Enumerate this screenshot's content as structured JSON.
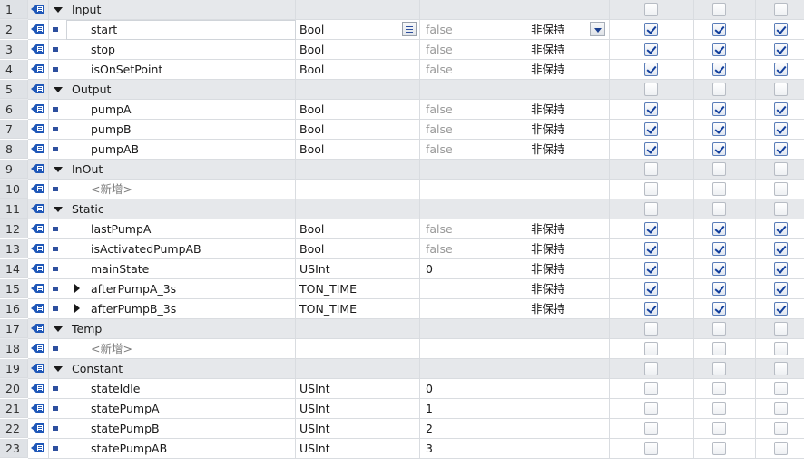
{
  "rows": [
    {
      "num": "1",
      "kind": "section",
      "name": "Input",
      "type": "",
      "default": "",
      "retain": "",
      "c1": false,
      "c2": false,
      "c3": false
    },
    {
      "num": "2",
      "kind": "var",
      "name": "start",
      "type": "Bool",
      "default": "false",
      "retain": "非保持",
      "c1": true,
      "c2": true,
      "c3": true,
      "selected": true
    },
    {
      "num": "3",
      "kind": "var",
      "name": "stop",
      "type": "Bool",
      "default": "false",
      "retain": "非保持",
      "c1": true,
      "c2": true,
      "c3": true
    },
    {
      "num": "4",
      "kind": "var",
      "name": "isOnSetPoint",
      "type": "Bool",
      "default": "false",
      "retain": "非保持",
      "c1": true,
      "c2": true,
      "c3": true
    },
    {
      "num": "5",
      "kind": "section",
      "name": "Output",
      "type": "",
      "default": "",
      "retain": "",
      "c1": false,
      "c2": false,
      "c3": false
    },
    {
      "num": "6",
      "kind": "var",
      "name": "pumpA",
      "type": "Bool",
      "default": "false",
      "retain": "非保持",
      "c1": true,
      "c2": true,
      "c3": true
    },
    {
      "num": "7",
      "kind": "var",
      "name": "pumpB",
      "type": "Bool",
      "default": "false",
      "retain": "非保持",
      "c1": true,
      "c2": true,
      "c3": true
    },
    {
      "num": "8",
      "kind": "var",
      "name": "pumpAB",
      "type": "Bool",
      "default": "false",
      "retain": "非保持",
      "c1": true,
      "c2": true,
      "c3": true
    },
    {
      "num": "9",
      "kind": "section",
      "name": "InOut",
      "type": "",
      "default": "",
      "retain": "",
      "c1": false,
      "c2": false,
      "c3": false
    },
    {
      "num": "10",
      "kind": "add",
      "name": "<新增>",
      "type": "",
      "default": "",
      "retain": "",
      "c1": false,
      "c2": false,
      "c3": false
    },
    {
      "num": "11",
      "kind": "section",
      "name": "Static",
      "type": "",
      "default": "",
      "retain": "",
      "c1": false,
      "c2": false,
      "c3": false
    },
    {
      "num": "12",
      "kind": "var",
      "name": "lastPumpA",
      "type": "Bool",
      "default": "false",
      "retain": "非保持",
      "c1": true,
      "c2": true,
      "c3": true
    },
    {
      "num": "13",
      "kind": "var",
      "name": "isActivatedPumpAB",
      "type": "Bool",
      "default": "false",
      "retain": "非保持",
      "c1": true,
      "c2": true,
      "c3": true
    },
    {
      "num": "14",
      "kind": "var",
      "name": "mainState",
      "type": "USInt",
      "default": "0",
      "retain": "非保持",
      "c1": true,
      "c2": true,
      "c3": true
    },
    {
      "num": "15",
      "kind": "struct",
      "name": "afterPumpA_3s",
      "type": "TON_TIME",
      "default": "",
      "retain": "非保持",
      "c1": true,
      "c2": true,
      "c3": true
    },
    {
      "num": "16",
      "kind": "struct",
      "name": "afterPumpB_3s",
      "type": "TON_TIME",
      "default": "",
      "retain": "非保持",
      "c1": true,
      "c2": true,
      "c3": true
    },
    {
      "num": "17",
      "kind": "section",
      "name": "Temp",
      "type": "",
      "default": "",
      "retain": "",
      "c1": false,
      "c2": false,
      "c3": false
    },
    {
      "num": "18",
      "kind": "add",
      "name": "<新增>",
      "type": "",
      "default": "",
      "retain": "",
      "c1": false,
      "c2": false,
      "c3": false
    },
    {
      "num": "19",
      "kind": "section",
      "name": "Constant",
      "type": "",
      "default": "",
      "retain": "",
      "c1": false,
      "c2": false,
      "c3": false
    },
    {
      "num": "20",
      "kind": "const",
      "name": "stateIdle",
      "type": "USInt",
      "default": "0",
      "retain": "",
      "c1": false,
      "c2": false,
      "c3": false
    },
    {
      "num": "21",
      "kind": "const",
      "name": "statePumpA",
      "type": "USInt",
      "default": "1",
      "retain": "",
      "c1": false,
      "c2": false,
      "c3": false
    },
    {
      "num": "22",
      "kind": "const",
      "name": "statePumpB",
      "type": "USInt",
      "default": "2",
      "retain": "",
      "c1": false,
      "c2": false,
      "c3": false
    },
    {
      "num": "23",
      "kind": "const",
      "name": "statePumpAB",
      "type": "USInt",
      "default": "3",
      "retain": "",
      "c1": false,
      "c2": false,
      "c3": false
    }
  ],
  "icons": {
    "interface": "interface-icon",
    "bullet": "variable-bullet-icon",
    "collapse": "collapse-triangle-icon",
    "expand": "expand-triangle-icon",
    "picker": "type-picker-icon",
    "dropdown": "dropdown-arrow-icon"
  },
  "colors": {
    "section_bg": "#e6e8eb",
    "check": "#123f9c",
    "interface_icon": "#1f57b8"
  }
}
